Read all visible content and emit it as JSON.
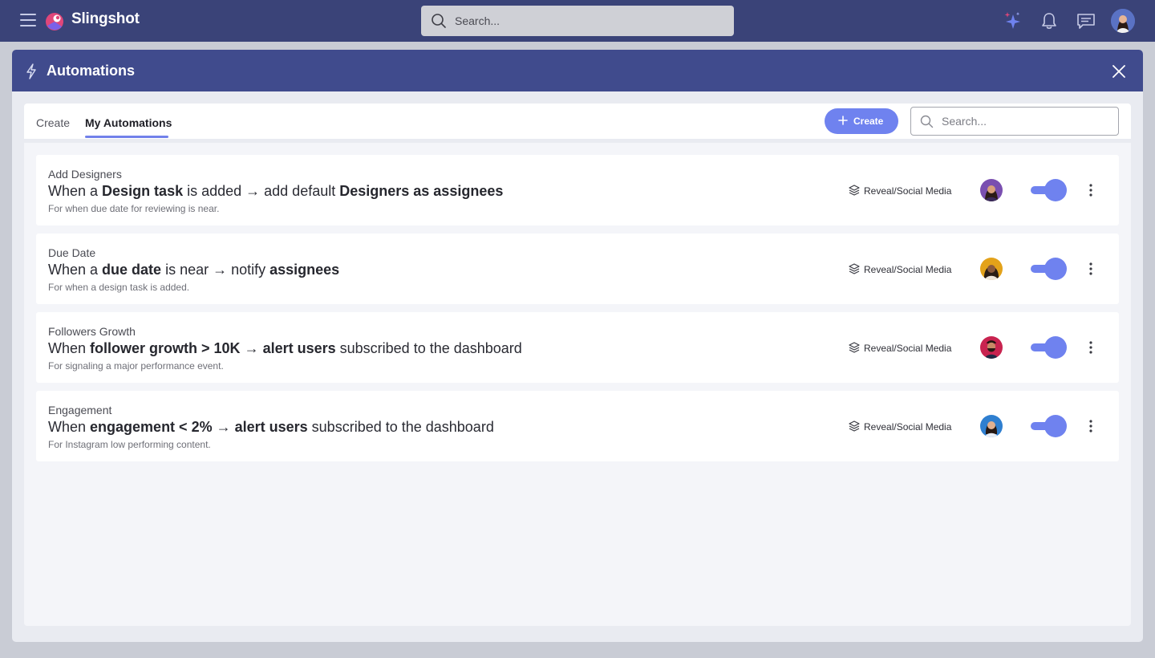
{
  "app": {
    "name": "Slingshot",
    "search_placeholder": "Search..."
  },
  "modal": {
    "title": "Automations",
    "tabs": [
      {
        "label": "Create"
      },
      {
        "label": "My Automations",
        "active": true
      }
    ],
    "create_button_label": "Create",
    "search_placeholder": "Search..."
  },
  "automations": [
    {
      "name": "Add Designers",
      "rule_parts": [
        {
          "text": "When a "
        },
        {
          "text": "Design task",
          "bold": true
        },
        {
          "text": " is added → add default "
        },
        {
          "text": "Designers as assignees",
          "bold": true
        }
      ],
      "description": "For when due date for reviewing is near.",
      "workspace": "Reveal/Social Media",
      "enabled": true
    },
    {
      "name": "Due Date",
      "rule_parts": [
        {
          "text": "When a "
        },
        {
          "text": "due date",
          "bold": true
        },
        {
          "text": " is near → notify "
        },
        {
          "text": "assignees",
          "bold": true
        }
      ],
      "description": "For when a design task is added.",
      "workspace": "Reveal/Social Media",
      "enabled": true
    },
    {
      "name": "Followers Growth",
      "rule_parts": [
        {
          "text": "When "
        },
        {
          "text": "follower growth > 10K",
          "bold": true
        },
        {
          "text": " → "
        },
        {
          "text": "alert users",
          "bold": true
        },
        {
          "text": " subscribed to the dashboard"
        }
      ],
      "description": "For signaling a major performance event.",
      "workspace": "Reveal/Social Media",
      "enabled": true
    },
    {
      "name": "Engagement",
      "rule_parts": [
        {
          "text": "When "
        },
        {
          "text": "engagement < 2%",
          "bold": true
        },
        {
          "text": " → "
        },
        {
          "text": "alert users",
          "bold": true
        },
        {
          "text": " subscribed to the dashboard"
        }
      ],
      "description": "For Instagram low performing content.",
      "workspace": "Reveal/Social Media",
      "enabled": true
    }
  ],
  "colors": {
    "topbar": "#3a4378",
    "modal_header": "#404b8d",
    "accent": "#6f82ef"
  },
  "icons": [
    "menu-icon",
    "slingshot-logo-icon",
    "search-icon",
    "sparkle-icon",
    "bell-icon",
    "chat-icon",
    "bolt-icon",
    "close-icon",
    "plus-icon",
    "layers-icon",
    "more-vertical-icon"
  ]
}
